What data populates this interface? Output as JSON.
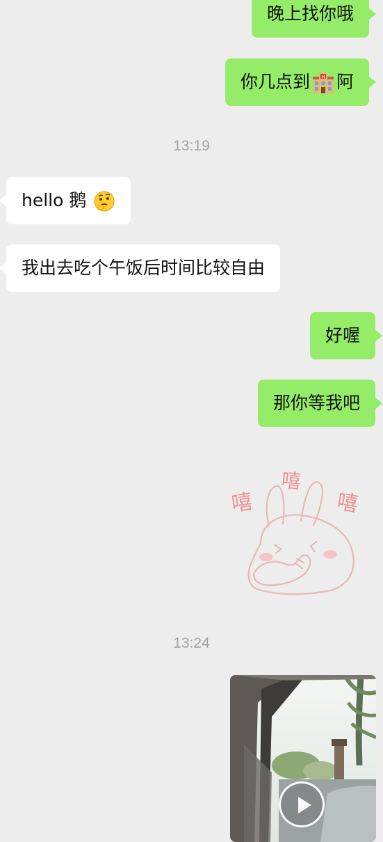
{
  "messages": [
    {
      "side": "out",
      "text": "晚上找你哦"
    },
    {
      "side": "out",
      "text_before": "你几点到",
      "emoji": "hotel-emoji",
      "text_after": "阿"
    },
    {
      "timestamp": "13:19"
    },
    {
      "side": "in",
      "text": "hello 鹅",
      "emoji": "thinking-face-emoji"
    },
    {
      "side": "in",
      "text": "我出去吃个午饭后时间比较自由"
    },
    {
      "side": "out",
      "text": "好喔"
    },
    {
      "side": "out",
      "text": "那你等我吧"
    },
    {
      "side": "out",
      "sticker": "rabbit-giggle-sticker",
      "sticker_text": [
        "嘻",
        "嘻",
        "嘻"
      ]
    },
    {
      "timestamp": "13:24"
    },
    {
      "side": "out",
      "video": "car-window-video",
      "action": "play-icon"
    }
  ],
  "colors": {
    "background": "#ededed",
    "outgoing_bubble": "#95ec69",
    "incoming_bubble": "#ffffff",
    "timestamp_text": "#a3a3a3",
    "sticker_text": "#ef8f8f"
  }
}
